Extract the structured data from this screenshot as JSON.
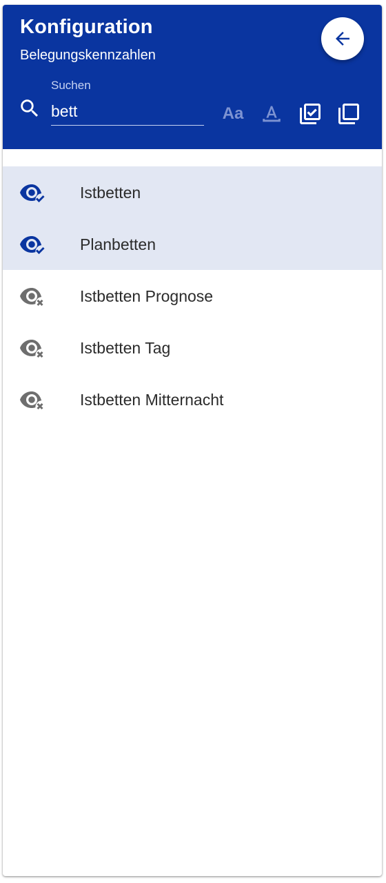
{
  "header": {
    "title": "Konfiguration",
    "subtitle": "Belegungskennzahlen",
    "back_icon": "arrow-left-icon"
  },
  "search": {
    "label": "Suchen",
    "value": "bett",
    "icon": "search-icon"
  },
  "toolbar": {
    "match_case_label": "Aa",
    "match_case_icon": "match-case-icon",
    "underline_icon": "text-underline-icon",
    "select_all_icon": "select-all-icon",
    "copy_icon": "copy-icon"
  },
  "items": [
    {
      "label": "Istbetten",
      "visible": true,
      "selected": true
    },
    {
      "label": "Planbetten",
      "visible": true,
      "selected": true
    },
    {
      "label": "Istbetten Prognose",
      "visible": false,
      "selected": false
    },
    {
      "label": "Istbetten Tag",
      "visible": false,
      "selected": false
    },
    {
      "label": "Istbetten Mitternacht",
      "visible": false,
      "selected": false
    }
  ],
  "colors": {
    "header_bg": "#0a35a0",
    "selected_row_bg": "#e2e7f3",
    "visible_icon": "#0a35a0",
    "hidden_icon": "#6e6e6e"
  }
}
